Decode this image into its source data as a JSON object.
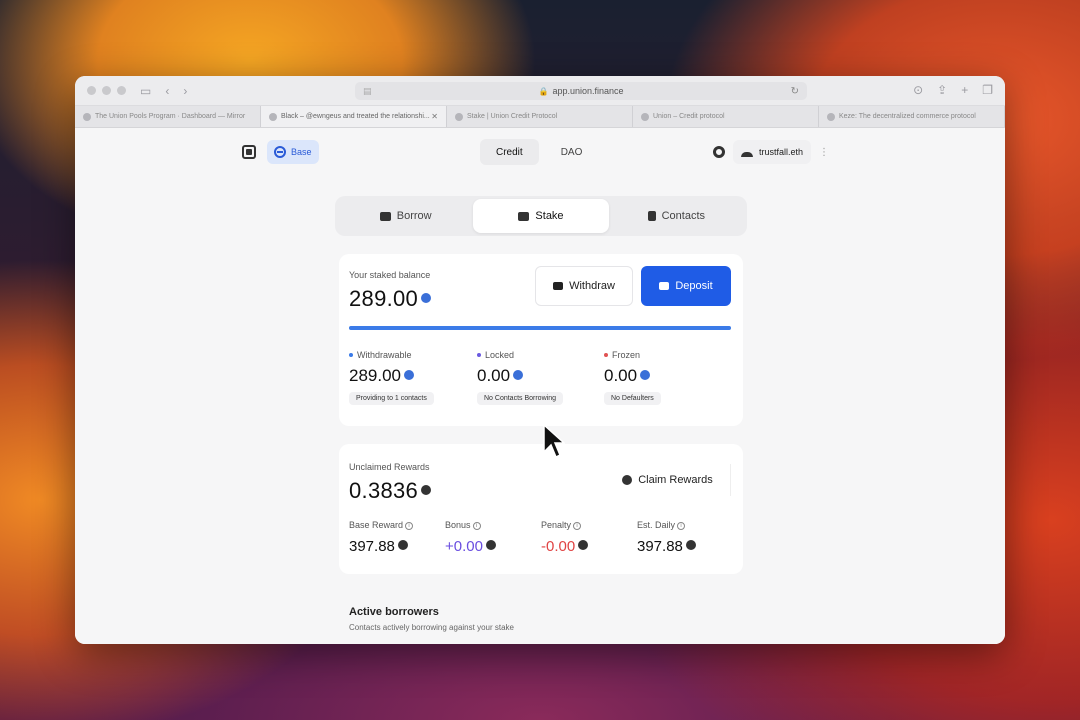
{
  "browser": {
    "url": "app.union.finance",
    "tabs": [
      {
        "title": "The Union Pools Program · Dashboard — Mirror",
        "active": false
      },
      {
        "title": "Black – @ewngeus and treated the relationshi...",
        "active": true
      },
      {
        "title": "Stake | Union Credit Protocol",
        "active": false
      },
      {
        "title": "Union – Credit protocol",
        "active": false
      },
      {
        "title": "Keze: The decentralized commerce protocol",
        "active": false
      }
    ]
  },
  "app": {
    "network_label": "Base",
    "nav": [
      {
        "label": "Credit",
        "active": true
      },
      {
        "label": "DAO",
        "active": false
      }
    ],
    "user": "trustfall.eth",
    "segment_tabs": [
      {
        "label": "Borrow",
        "active": false
      },
      {
        "label": "Stake",
        "active": true
      },
      {
        "label": "Contacts",
        "active": false
      }
    ]
  },
  "stake": {
    "balance_label": "Your staked balance",
    "balance": "289.00",
    "withdraw_label": "Withdraw",
    "deposit_label": "Deposit",
    "progress_fraction": 1.0,
    "stats": [
      {
        "label": "Withdrawable",
        "value": "289.00",
        "badge": "Providing to 1 contacts",
        "color": "#3b7be8"
      },
      {
        "label": "Locked",
        "value": "0.00",
        "badge": "No Contacts Borrowing",
        "color": "#6a5ae0"
      },
      {
        "label": "Frozen",
        "value": "0.00",
        "badge": "No Defaulters",
        "color": "#e05252"
      }
    ]
  },
  "rewards": {
    "label": "Unclaimed Rewards",
    "value": "0.3836",
    "claim_label": "Claim Rewards",
    "breakdown": [
      {
        "label": "Base Reward",
        "value": "397.88",
        "color": "#111111"
      },
      {
        "label": "Bonus",
        "value": "+0.00",
        "color": "#6a4ee0"
      },
      {
        "label": "Penalty",
        "value": "-0.00",
        "color": "#e04444"
      },
      {
        "label": "Est. Daily",
        "value": "397.88",
        "color": "#111111"
      }
    ]
  },
  "borrowers": {
    "title": "Active borrowers",
    "subtitle": "Contacts actively borrowing against your stake"
  }
}
